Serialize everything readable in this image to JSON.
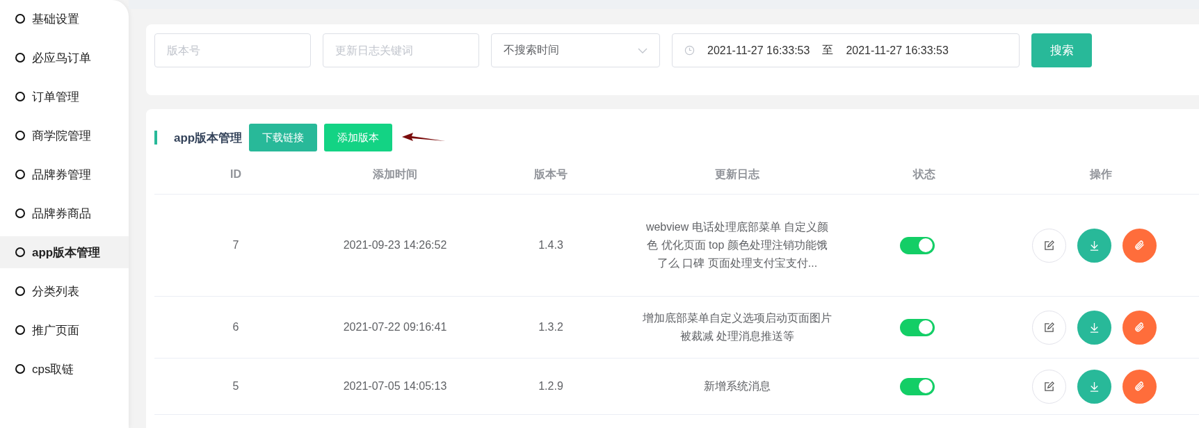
{
  "sidebar": {
    "items": [
      {
        "label": "基础设置",
        "selected": false
      },
      {
        "label": "必应鸟订单",
        "selected": false
      },
      {
        "label": "订单管理",
        "selected": false
      },
      {
        "label": "商学院管理",
        "selected": false
      },
      {
        "label": "品牌券管理",
        "selected": false
      },
      {
        "label": "品牌券商品",
        "selected": false
      },
      {
        "label": "app版本管理",
        "selected": true
      },
      {
        "label": "分类列表",
        "selected": false
      },
      {
        "label": "推广页面",
        "selected": false
      },
      {
        "label": "cps取链",
        "selected": false
      }
    ]
  },
  "filters": {
    "version": {
      "placeholder": "版本号"
    },
    "keyword": {
      "placeholder": "更新日志关键词"
    },
    "time_mode": {
      "value": "不搜索时间"
    },
    "date_range": {
      "start": "2021-11-27 16:33:53",
      "separator": "至",
      "end": "2021-11-27 16:33:53"
    },
    "search_button": "搜索"
  },
  "panel": {
    "title": "app版本管理",
    "buttons": [
      "下载链接",
      "添加版本"
    ]
  },
  "table": {
    "columns": [
      "ID",
      "添加时间",
      "版本号",
      "更新日志",
      "状态",
      "操作"
    ],
    "rows": [
      {
        "id": "7",
        "time": "2021-09-23 14:26:52",
        "version": "1.4.3",
        "log": "webview 电话处理底部菜单 自定义颜色 优化页面 top 颜色处理注销功能饿了么 口碑 页面处理支付宝支付...",
        "on": true
      },
      {
        "id": "6",
        "time": "2021-07-22 09:16:41",
        "version": "1.3.2",
        "log": "增加底部菜单自定义选项启动页面图片被裁减 处理消息推送等",
        "on": true
      },
      {
        "id": "5",
        "time": "2021-07-05 14:05:13",
        "version": "1.2.9",
        "log": "新增系统消息",
        "on": true
      }
    ]
  }
}
